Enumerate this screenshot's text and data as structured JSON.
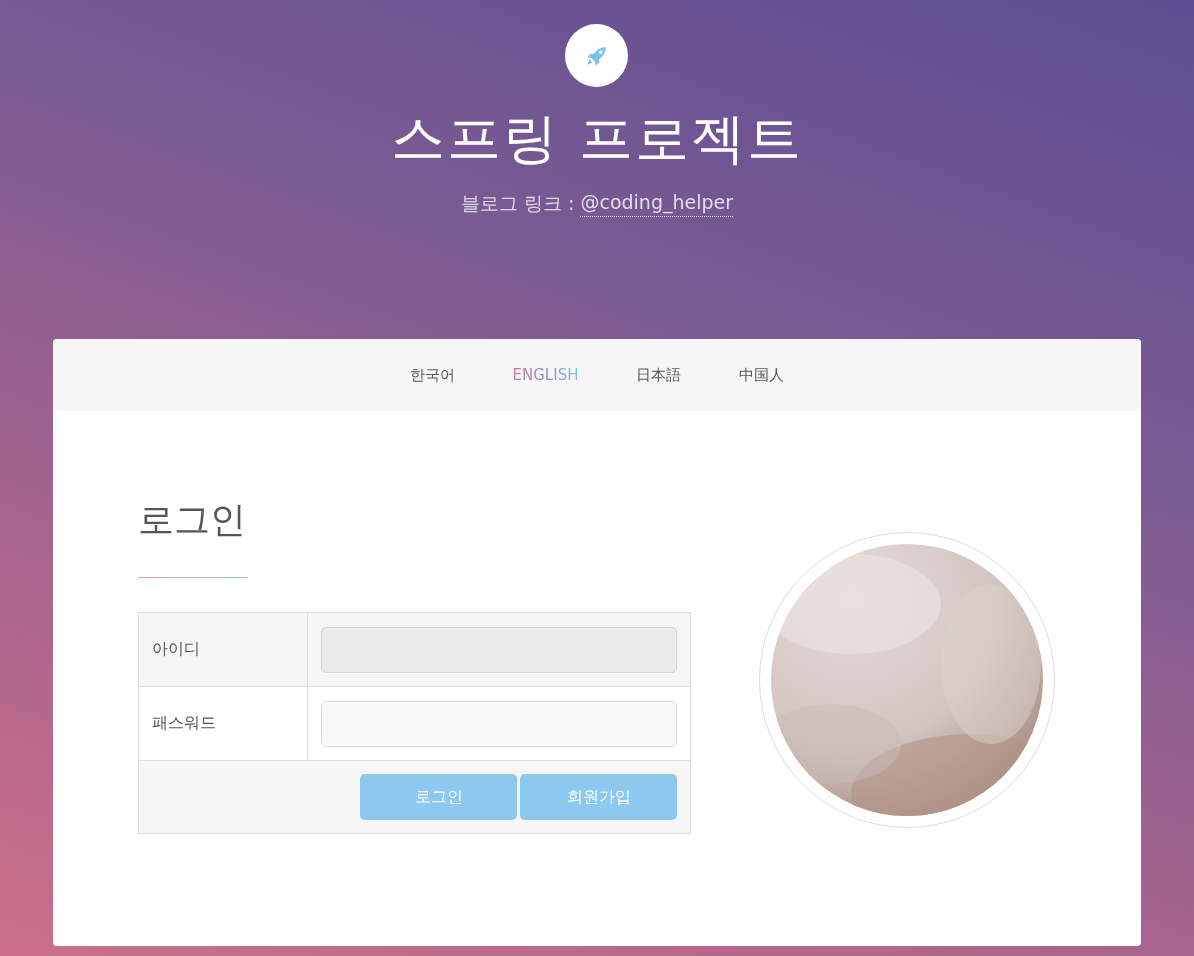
{
  "header": {
    "title": "스프링 프로젝트",
    "blog_label": "블로그 링크 :",
    "blog_link": "@coding_helper"
  },
  "languages": [
    {
      "label": "한국어",
      "selected": false
    },
    {
      "label": "ENGLISH",
      "selected": true
    },
    {
      "label": "日本語",
      "selected": false
    },
    {
      "label": "中国人",
      "selected": false
    }
  ],
  "login": {
    "heading": "로그인",
    "fields": [
      {
        "label": "아이디"
      },
      {
        "label": "패스워드"
      }
    ],
    "buttons": [
      "로그인",
      "회원가입"
    ]
  }
}
